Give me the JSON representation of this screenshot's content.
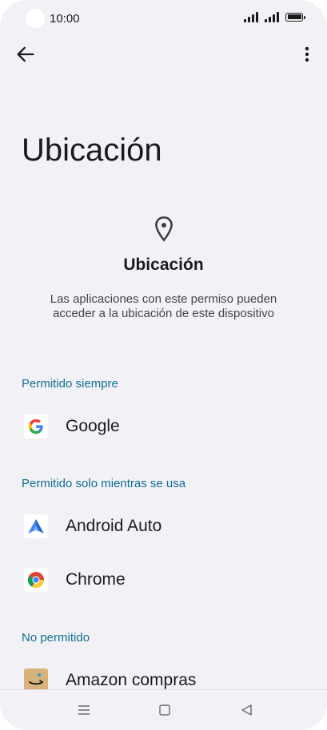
{
  "status_bar": {
    "time": "10:00"
  },
  "page": {
    "title": "Ubicación"
  },
  "header": {
    "title": "Ubicación",
    "description": "Las aplicaciones con este permiso pueden acceder a la ubicación de este dispositivo"
  },
  "sections": {
    "always": {
      "label": "Permitido siempre",
      "items": [
        {
          "label": "Google"
        }
      ]
    },
    "while_using": {
      "label": "Permitido solo mientras se usa",
      "items": [
        {
          "label": "Android Auto"
        },
        {
          "label": "Chrome"
        }
      ]
    },
    "denied": {
      "label": "No permitido",
      "items": [
        {
          "label": "Amazon compras"
        }
      ]
    }
  },
  "colors": {
    "section_header": "#0f6f8f",
    "background": "#f2f1f6"
  }
}
